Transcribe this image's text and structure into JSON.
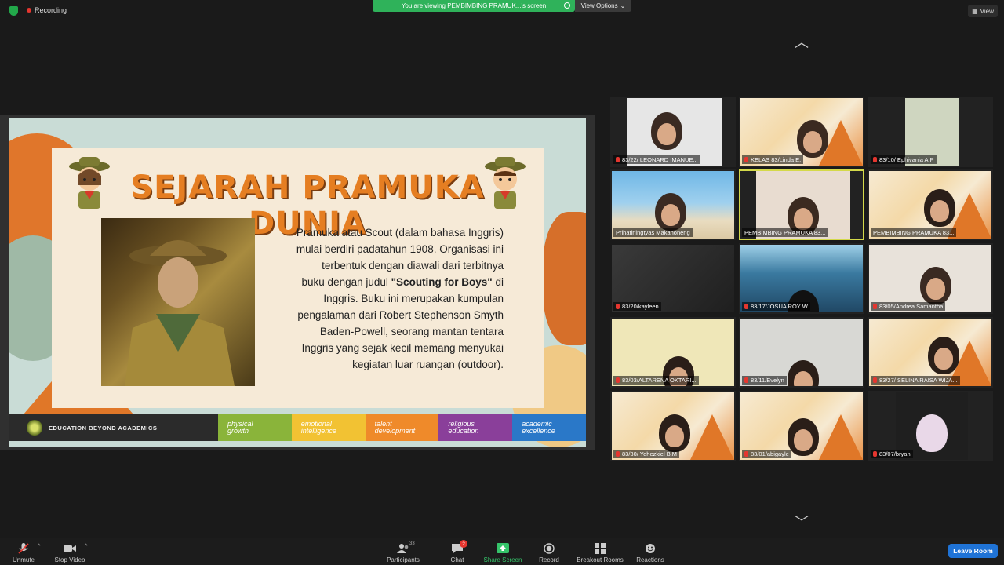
{
  "topbar": {
    "recording_label": "Recording",
    "viewing_label": "You are viewing PEMBIMBING PRAMUK...'s screen",
    "view_options_label": "View Options",
    "view_label": "View"
  },
  "slide": {
    "title": "SEJARAH PRAMUKA DUNIA",
    "body_lines": [
      "Pramuka atau Scout (dalam bahasa Inggris)",
      "mulai berdiri padatahun 1908. Organisasi ini",
      "terbentuk dengan diawali dari terbitnya",
      "buku dengan judul",
      "\"Scouting for Boys\"",
      "di",
      "Inggris. Buku ini merupakan kumpulan",
      "pengalaman dari Robert Stephenson Smyth",
      "Baden-Powell, seorang mantan tentara",
      "Inggris yang sejak kecil memang menyukai",
      "kegiatan luar ruangan (outdoor)."
    ],
    "footer_brand": "EDUCATION BEYOND ACADEMICS",
    "pillars": [
      {
        "line1": "physical",
        "line2": "growth",
        "color": "#8ab43a"
      },
      {
        "line1": "emotional",
        "line2": "intelligence",
        "color": "#f2c233"
      },
      {
        "line1": "talent",
        "line2": "development",
        "color": "#ef8a2a"
      },
      {
        "line1": "religious",
        "line2": "education",
        "color": "#8a3f9a"
      },
      {
        "line1": "academic",
        "line2": "excellence",
        "color": "#2a78c8"
      }
    ]
  },
  "participants": [
    {
      "name": "83/22/ LEONARD IMANUE...",
      "muted": true
    },
    {
      "name": "KELAS 83/Linda E.",
      "muted": true
    },
    {
      "name": "83/10/ Ephivania A.P",
      "muted": true
    },
    {
      "name": "Prihatiningtyas Makanoneng",
      "muted": false
    },
    {
      "name": "PEMBIMBING PRAMUKA 83...",
      "muted": false,
      "active": true
    },
    {
      "name": "PEMBIMBING PRAMUKA 83...",
      "muted": false
    },
    {
      "name": "83/20/kayleen",
      "muted": true
    },
    {
      "name": "83/17/JOSUA ROY W",
      "muted": true
    },
    {
      "name": "83/05/Andrea Samantha",
      "muted": true
    },
    {
      "name": "83/03/ALTARENA OKTARI...",
      "muted": true
    },
    {
      "name": "83/11/Evelyn",
      "muted": true
    },
    {
      "name": "83/27/ SELINA RAISA WIJA...",
      "muted": true
    },
    {
      "name": "83/30/ Yehezkiel B.M",
      "muted": true
    },
    {
      "name": "83/01/abigayle",
      "muted": true
    },
    {
      "name": "83/07/bryan",
      "muted": true
    }
  ],
  "toolbar": {
    "unmute": "Unmute",
    "stop_video": "Stop Video",
    "participants": "Participants",
    "participants_count": "33",
    "chat": "Chat",
    "chat_badge": "2",
    "share_screen": "Share Screen",
    "record": "Record",
    "breakout_rooms": "Breakout Rooms",
    "reactions": "Reactions",
    "leave_room": "Leave Room"
  }
}
